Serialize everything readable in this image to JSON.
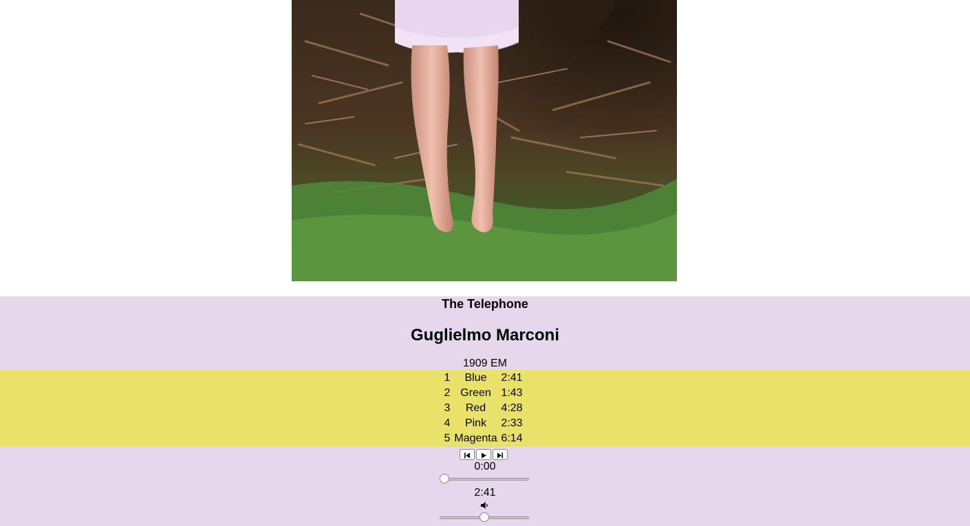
{
  "album": {
    "title": "The Telephone",
    "artist": "Guglielmo Marconi",
    "release": "1909 EM",
    "cover_icon": "album-cover-photo"
  },
  "tracks": [
    {
      "number": "1",
      "name": "Blue",
      "duration": "2:41"
    },
    {
      "number": "2",
      "name": "Green",
      "duration": "1:43"
    },
    {
      "number": "3",
      "name": "Red",
      "duration": "4:28"
    },
    {
      "number": "4",
      "name": "Pink",
      "duration": "2:33"
    },
    {
      "number": "5",
      "name": "Magenta",
      "duration": "6:14"
    }
  ],
  "player": {
    "controls": [
      {
        "icon": "skip-back-icon"
      },
      {
        "icon": "play-icon"
      },
      {
        "icon": "skip-forward-icon"
      }
    ],
    "current_time": "0:00",
    "total_time": "2:41",
    "progress": 0,
    "volume_icon": "speaker-icon",
    "volume": 0.5
  },
  "colors": {
    "info_band": "#e6d7ec",
    "tracklist_band": "#e9e26a"
  }
}
